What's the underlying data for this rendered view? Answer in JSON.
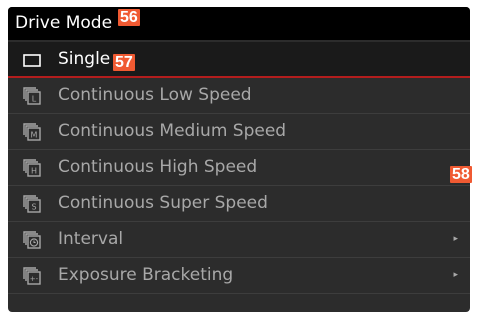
{
  "header": {
    "title": "Drive Mode"
  },
  "callouts": {
    "c56": "56",
    "c57": "57",
    "c58": "58"
  },
  "menu": {
    "items": [
      {
        "label": "Single",
        "icon": "single-frame-icon",
        "selected": true
      },
      {
        "label": "Continuous Low Speed",
        "icon": "continuous-low-icon",
        "glyph": "L"
      },
      {
        "label": "Continuous Medium Speed",
        "icon": "continuous-medium-icon",
        "glyph": "M"
      },
      {
        "label": "Continuous High Speed",
        "icon": "continuous-high-icon",
        "glyph": "H"
      },
      {
        "label": "Continuous Super Speed",
        "icon": "continuous-super-icon",
        "glyph": "S"
      },
      {
        "label": "Interval",
        "icon": "interval-icon",
        "submenu_arrow": "▸"
      },
      {
        "label": "Exposure Bracketing",
        "icon": "exposure-bracketing-icon",
        "glyph": "+-",
        "submenu_arrow": "▸"
      }
    ]
  },
  "colors": {
    "screen_bg": "#2c2c2c",
    "title_bg": "#000000",
    "selected_bg": "#1a1a1a",
    "selected_underline": "#b31d1d",
    "text_selected": "#ffffff",
    "text_normal": "#a8a8a8",
    "callout": "#f05a32"
  }
}
